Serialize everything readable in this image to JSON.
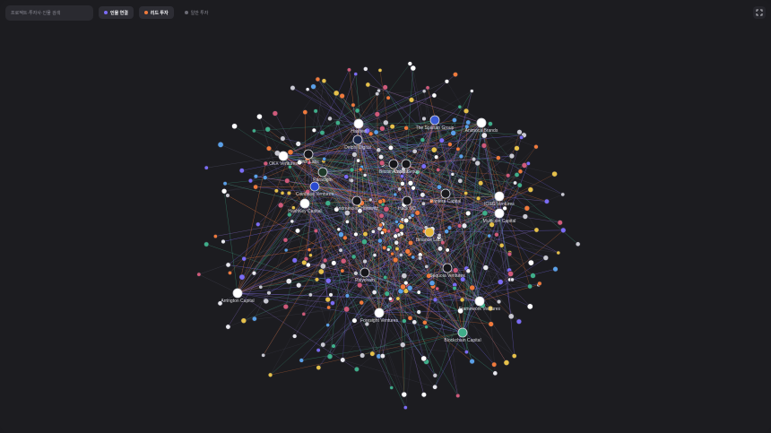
{
  "toolbar": {
    "search_placeholder": "프로젝트·투자사·인물 검색",
    "filters": [
      {
        "label": "인물 연결",
        "color": "#7b6cf6",
        "active": true
      },
      {
        "label": "리드 투자",
        "color": "#f07a3c",
        "active": true
      },
      {
        "label": "일반 투자",
        "color": "#6b6b75",
        "active": false
      }
    ],
    "corner_icon": "fullscreen-icon"
  },
  "colors": {
    "background": "#1c1c20",
    "edge_person": "#7b6cf6",
    "edge_lead": "#f07a3c",
    "edge_normal": "#3fae8a"
  },
  "investors": [
    {
      "name": "Hashed",
      "icon": "hashed-icon"
    },
    {
      "name": "Delphi Digital",
      "icon": "delphi-icon"
    },
    {
      "name": "OKX Ventures",
      "icon": "okx-icon"
    },
    {
      "name": "DWF Labs",
      "icon": "dwf-icon"
    },
    {
      "name": "Paradigm",
      "icon": "paradigm-icon"
    },
    {
      "name": "Coinbase Ventures",
      "icon": "coinbase-icon"
    },
    {
      "name": "HashKey Capital",
      "icon": "hashkey-icon"
    },
    {
      "name": "Andreessen Horowitz",
      "icon": "a16z-icon"
    },
    {
      "name": "Hack VC",
      "icon": "hackvc-icon"
    },
    {
      "name": "Pantera Capital",
      "icon": "pantera-icon"
    },
    {
      "name": "Binance Labs",
      "icon": "binance-icon"
    },
    {
      "name": "Animoca Brands",
      "icon": "animoca-icon"
    },
    {
      "name": "The Spartan Group",
      "icon": "spartan-icon"
    },
    {
      "name": "Amber Group",
      "icon": "amber-icon"
    },
    {
      "name": "IOSG Ventures",
      "icon": "iosg-icon"
    },
    {
      "name": "Multicoin Capital",
      "icon": "multicoin-icon"
    },
    {
      "name": "Framework Ventures",
      "icon": "framework-icon"
    },
    {
      "name": "Polychain",
      "icon": "polychain-icon"
    },
    {
      "name": "Arrington Capital",
      "icon": "arrington-icon"
    },
    {
      "name": "Sequoia Ventures",
      "icon": "sequoia-icon"
    },
    {
      "name": "Foresight Ventures",
      "icon": "foresight-icon"
    },
    {
      "name": "Blockchain Capital",
      "icon": "blockchain-icon"
    },
    {
      "name": "Bitcoin Capital",
      "icon": "bitcoin-capital-icon"
    }
  ]
}
